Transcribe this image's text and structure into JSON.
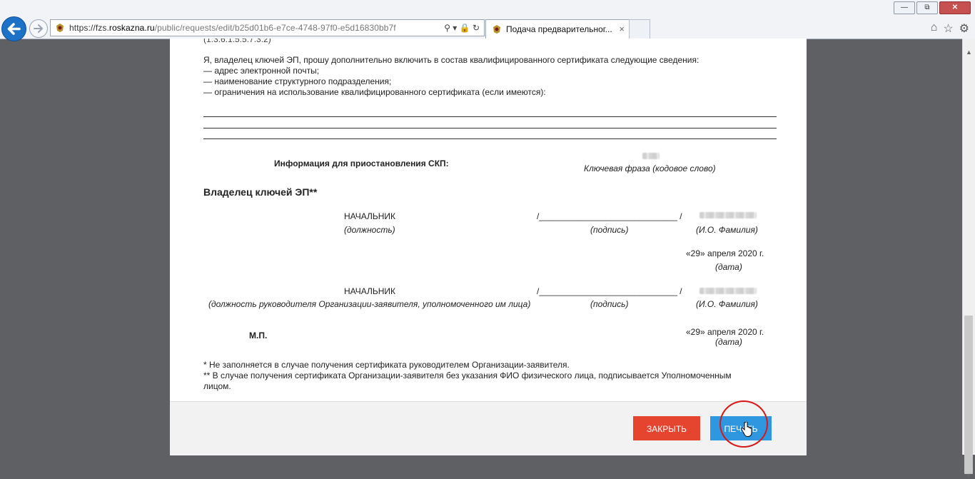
{
  "browser": {
    "url_scheme": "https://fzs.",
    "url_host": "roskazna.ru",
    "url_path": "/public/requests/edit/b25d01b6-e7ce-4748-97f0-e5d16830bb7f",
    "tab_title": "Подача предварительног...",
    "tab_close": "×",
    "win_minimize": "—",
    "win_restore": "⧉",
    "win_close": "✕",
    "addr_icons": "⚲ ▾ 🔒 ↻",
    "home_icon": "⌂",
    "star_icon": "☆",
    "gear_icon": "⚙"
  },
  "document": {
    "top_cut": "(1.3.6.1.5.5.7.3.2)",
    "include_intro": "Я, владелец ключей ЭП, прошу дополнительно включить в состав квалифицированного сертификата следующие сведения:",
    "item_email": "— адрес электронной почты;",
    "item_dept": "— наименование структурного подразделения;",
    "item_limits": "— ограничения на использование квалифицированного сертификата (если имеются):",
    "suspend_info": "Информация для приостановления СКП:",
    "passphrase_caption": "Ключевая фраза (кодовое слово)",
    "owner_heading": "Владелец ключей ЭП**",
    "position_1": "НАЧАЛЬНИК",
    "position_caption_1": "(должность)",
    "signature_line": "/_____________________________ /",
    "signature_caption": "(подпись)",
    "name_caption": "(И.О. Фамилия)",
    "date_value": "«29» апреля 2020 г.",
    "date_caption": "(дата)",
    "position_2": "НАЧАЛЬНИК",
    "position_caption_2": "(должность руководителя Организации-заявителя, уполномоченного им лица)",
    "stamp": "М.П.",
    "footnote_1": "* Не заполняется в случае получения сертификата руководителем Организации-заявителя.",
    "footnote_2a": "** В случае получения сертификата Организации-заявителя без указания ФИО физического лица, подписывается Уполномоченным",
    "footnote_2b": "лицом."
  },
  "buttons": {
    "close_label": "ЗАКРЫТЬ",
    "print_label": "ПЕЧАТЬ"
  },
  "colors": {
    "close_button": "#e5452f",
    "print_button": "#2f97e0",
    "highlight_circle": "#d81818"
  }
}
